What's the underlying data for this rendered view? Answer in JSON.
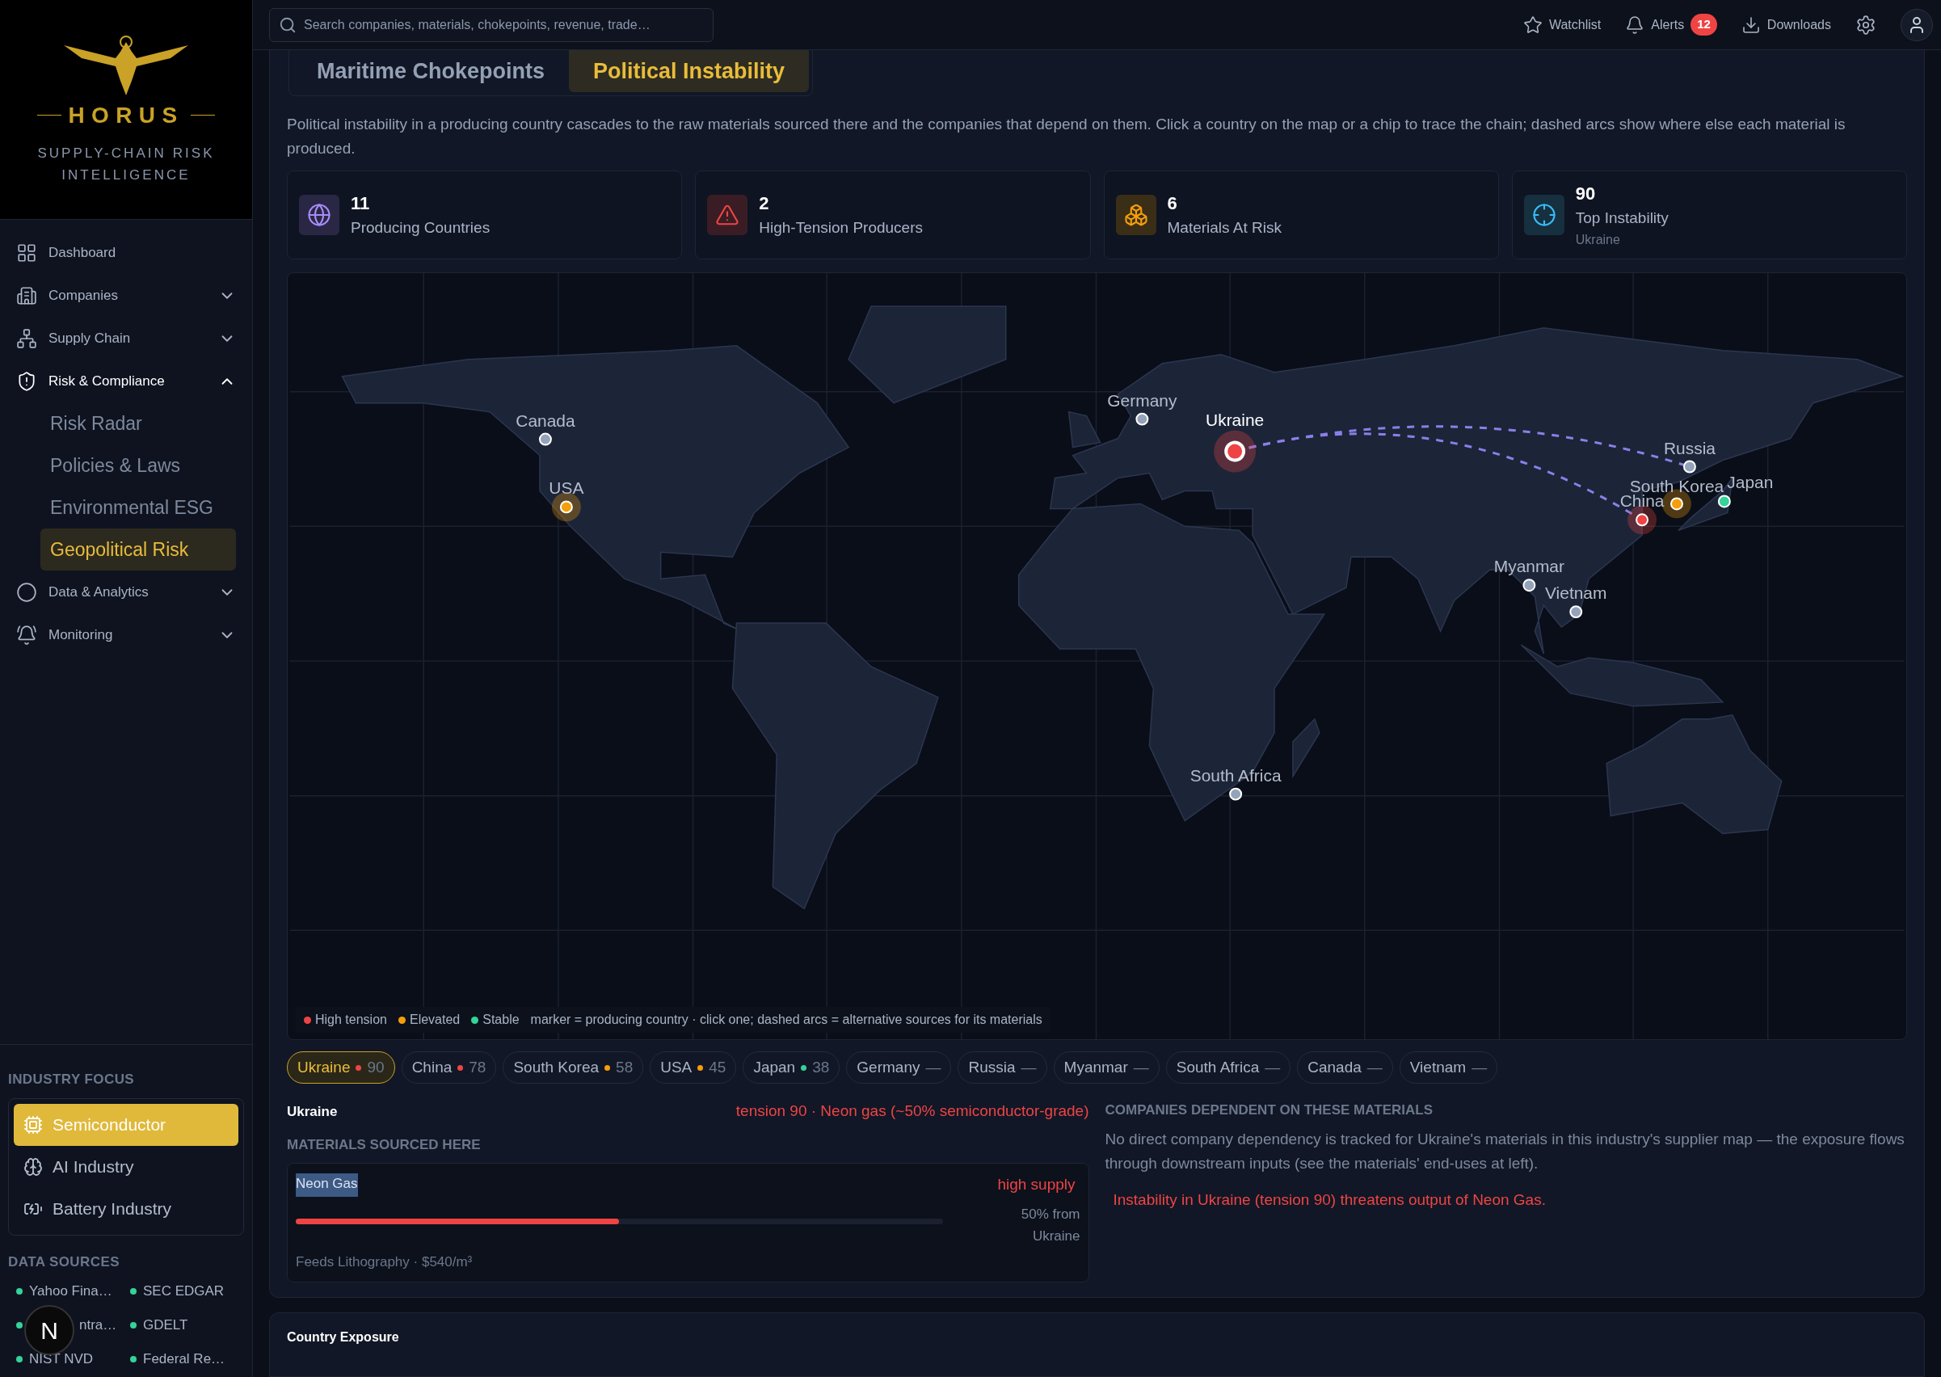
{
  "sidebar": {
    "brand": {
      "name": "HORUS",
      "tagline": "SUPPLY-CHAIN RISK INTELLIGENCE"
    },
    "nav": [
      {
        "label": "Dashboard",
        "kind": "link"
      },
      {
        "label": "Companies",
        "kind": "group",
        "expanded": false
      },
      {
        "label": "Supply Chain",
        "kind": "group",
        "expanded": false
      },
      {
        "label": "Risk & Compliance",
        "kind": "group",
        "expanded": true,
        "children": [
          {
            "label": "Risk Radar",
            "selected": false
          },
          {
            "label": "Policies & Laws",
            "selected": false
          },
          {
            "label": "Environmental ESG",
            "selected": false
          },
          {
            "label": "Geopolitical Risk",
            "selected": true
          }
        ]
      },
      {
        "label": "Data & Analytics",
        "kind": "group",
        "expanded": false
      },
      {
        "label": "Monitoring",
        "kind": "group",
        "expanded": false
      }
    ],
    "industry_focus": {
      "title": "INDUSTRY FOCUS",
      "items": [
        {
          "label": "Semiconductor",
          "selected": true
        },
        {
          "label": "AI Industry",
          "selected": false
        },
        {
          "label": "Battery Industry",
          "selected": false
        }
      ]
    },
    "data_sources": {
      "title": "DATA SOURCES",
      "items": [
        {
          "label": "Yahoo Fina…",
          "color": "#34d399",
          "covered": false
        },
        {
          "label": "SEC EDGAR",
          "color": "#34d399",
          "covered": false
        },
        {
          "label": "ntra…",
          "color": "#34d399",
          "covered": true
        },
        {
          "label": "GDELT",
          "color": "#34d399",
          "covered": false
        },
        {
          "label": "NIST NVD",
          "color": "#34d399",
          "covered": false
        },
        {
          "label": "Federal Re…",
          "color": "#34d399",
          "covered": false
        }
      ]
    },
    "dev_badge": {
      "label": "N"
    }
  },
  "topbar": {
    "search": {
      "placeholder": "Search companies, materials, chokepoints, revenue, trade…"
    },
    "actions": [
      {
        "label": "Watchlist"
      },
      {
        "label": "Alerts",
        "badge": "12"
      },
      {
        "label": "Downloads"
      }
    ]
  },
  "tabs": [
    {
      "label": "Maritime Chokepoints",
      "selected": false
    },
    {
      "label": "Political Instability",
      "selected": true
    }
  ],
  "description": "Political instability in a producing country cascades to the raw materials sourced there and the companies that depend on them. Click a country on the map or a chip to trace the chain; dashed arcs show where else each material is produced.",
  "stats": [
    {
      "value": "11",
      "label": "Producing Countries"
    },
    {
      "value": "2",
      "label": "High-Tension Producers"
    },
    {
      "value": "6",
      "label": "Materials At Risk"
    },
    {
      "value": "90",
      "label": "Top Instability",
      "sub": "Ukraine"
    }
  ],
  "map": {
    "markers": [
      {
        "label": "Canada",
        "color": "#94a3b8",
        "selected": false,
        "alternative_source": false
      },
      {
        "label": "USA",
        "color": "#f59e0b",
        "selected": false,
        "alternative_source": false
      },
      {
        "label": "Germany",
        "color": "#94a3b8",
        "selected": false,
        "alternative_source": false
      },
      {
        "label": "Ukraine",
        "color": "#ef4444",
        "selected": true,
        "alternative_source": false
      },
      {
        "label": "Russia",
        "color": "#94a3b8",
        "selected": false,
        "alternative_source": true
      },
      {
        "label": "South Korea",
        "color": "#f59e0b",
        "selected": false,
        "alternative_source": false
      },
      {
        "label": "Japan",
        "color": "#34d399",
        "selected": false,
        "alternative_source": false
      },
      {
        "label": "China",
        "color": "#ef4444",
        "selected": false,
        "alternative_source": true
      },
      {
        "label": "Myanmar",
        "color": "#94a3b8",
        "selected": false,
        "alternative_source": false
      },
      {
        "label": "Vietnam",
        "color": "#94a3b8",
        "selected": false,
        "alternative_source": false
      },
      {
        "label": "South Africa",
        "color": "#94a3b8",
        "selected": false,
        "alternative_source": false
      }
    ],
    "legend": [
      {
        "label": "High tension",
        "color": "#ef4444"
      },
      {
        "label": "Elevated",
        "color": "#f59e0b"
      },
      {
        "label": "Stable",
        "color": "#34d399"
      }
    ],
    "note": "marker = producing country · click one; dashed arcs = alternative sources for its materials"
  },
  "chips": [
    {
      "label": "Ukraine",
      "score": "90",
      "color": "#ef4444",
      "selected": true
    },
    {
      "label": "China",
      "score": "78",
      "color": "#ef4444",
      "selected": false
    },
    {
      "label": "South Korea",
      "score": "58",
      "color": "#f59e0b",
      "selected": false
    },
    {
      "label": "USA",
      "score": "45",
      "color": "#f59e0b",
      "selected": false
    },
    {
      "label": "Japan",
      "score": "38",
      "color": "#34d399",
      "selected": false
    },
    {
      "label": "Germany",
      "score": "—",
      "selected": false
    },
    {
      "label": "Russia",
      "score": "—",
      "selected": false
    },
    {
      "label": "Myanmar",
      "score": "—",
      "selected": false
    },
    {
      "label": "South Africa",
      "score": "—",
      "selected": false
    },
    {
      "label": "Canada",
      "score": "—",
      "selected": false
    },
    {
      "label": "Vietnam",
      "score": "—",
      "selected": false
    }
  ],
  "detail": {
    "country": "Ukraine",
    "summary": "tension 90 · Neon gas (~50% semiconductor-grade)",
    "materials_title": "MATERIALS SOURCED HERE",
    "materials": [
      {
        "name": "Neon Gas",
        "highlighted": true,
        "supply": "high supply",
        "level": 0.5,
        "share": "50% from Ukraine",
        "feeds": "Feeds Lithography · $540/m³"
      }
    ],
    "companies_title": "COMPANIES DEPENDENT ON THESE MATERIALS",
    "companies_note": "No direct company dependency is tracked for Ukraine's materials in this industry's supplier map — the exposure flows through downstream inputs (see the materials' end-uses at left).",
    "threat": "Instability in Ukraine (tension 90) threatens output of Neon Gas."
  },
  "next_card": {
    "title": "Country Exposure"
  }
}
